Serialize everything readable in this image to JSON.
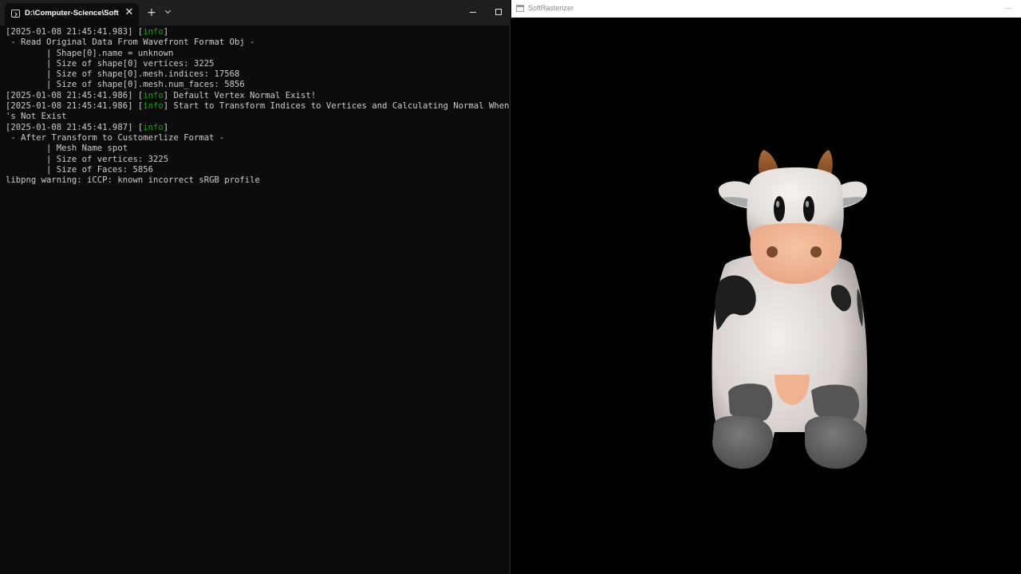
{
  "terminal": {
    "tab_title": "D:\\Computer-Science\\Softwa",
    "close_glyph": "✕",
    "new_tab_glyph": "+",
    "lines": [
      [
        {
          "t": "[2025-01-08 21:45:41.983] ["
        },
        {
          "t": "info",
          "c": "info"
        },
        {
          "t": "]"
        }
      ],
      [
        {
          "t": " - Read Original Data From Wavefront Format Obj -"
        }
      ],
      [
        {
          "t": "        | Shape[0].name = unknown"
        }
      ],
      [
        {
          "t": "        | Size of shape[0] vertices: 3225"
        }
      ],
      [
        {
          "t": "        | Size of shape[0].mesh.indices: 17568"
        }
      ],
      [
        {
          "t": "        | Size of shape[0].mesh.num_faces: 5856"
        }
      ],
      [
        {
          "t": "[2025-01-08 21:45:41.986] ["
        },
        {
          "t": "info",
          "c": "info"
        },
        {
          "t": "] Default Vertex Normal Exist!"
        }
      ],
      [
        {
          "t": "[2025-01-08 21:45:41.986] ["
        },
        {
          "t": "info",
          "c": "info"
        },
        {
          "t": "] Start to Transform Indices to Vertices and Calculating Normal When i"
        }
      ],
      [
        {
          "t": "'s Not Exist"
        }
      ],
      [
        {
          "t": "[2025-01-08 21:45:41.987] ["
        },
        {
          "t": "info",
          "c": "info"
        },
        {
          "t": "]"
        }
      ],
      [
        {
          "t": " - After Transform to Customerlize Format -"
        }
      ],
      [
        {
          "t": "        | Mesh Name spot"
        }
      ],
      [
        {
          "t": "        | Size of vertices: 3225"
        }
      ],
      [
        {
          "t": "        | Size of Faces: 5856"
        }
      ],
      [
        {
          "t": "libpng warning: iCCP: known incorrect sRGB profile"
        }
      ]
    ]
  },
  "viewer": {
    "title": "SoftRasterizer",
    "content_icon": "cow-model"
  },
  "colors": {
    "terminal_bg": "#0c0c0c",
    "terminal_text": "#cccccc",
    "info_green": "#13a10e",
    "titlebar_dark": "#1f1f1f"
  }
}
